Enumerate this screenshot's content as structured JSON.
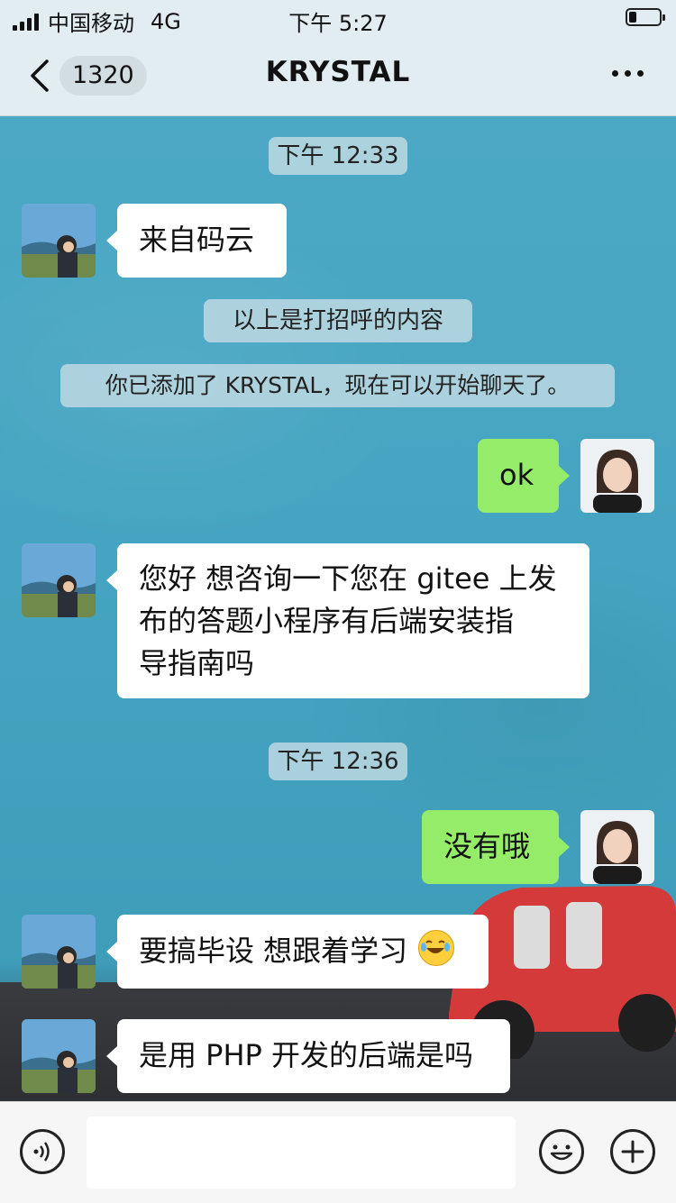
{
  "status_bar": {
    "carrier": "中国移动",
    "network": "4G",
    "time": "下午 5:27",
    "battery_level": 0.25
  },
  "nav": {
    "back_label": "1320",
    "title": "KRYSTAL"
  },
  "system_notes": {
    "time1": "下午 12:33",
    "greeting_note": "以上是打招呼的内容",
    "added_note": "你已添加了 KRYSTAL，现在可以开始聊天了。",
    "time2": "下午 12:36"
  },
  "messages": {
    "m1": "来自码云",
    "m2": "ok",
    "m3_line1": "您好 想咨询一下您在 gitee 上发",
    "m3_line2": "布的答题小程序有后端安装指",
    "m3_line3": "导指南吗",
    "m4": "没有哦",
    "m5": "要搞毕设 想跟着学习",
    "m6": "是用 PHP 开发的后端是吗"
  },
  "icons": {
    "m5_emoji": "tears-of-joy-emoji",
    "voice": "voice-icon",
    "emoji": "emoji-icon",
    "plus": "plus-icon"
  },
  "colors": {
    "outgoing_bubble": "#95ec69",
    "incoming_bubble": "#ffffff",
    "header": "#e2edf2",
    "chat_background": "#45a7c3"
  }
}
